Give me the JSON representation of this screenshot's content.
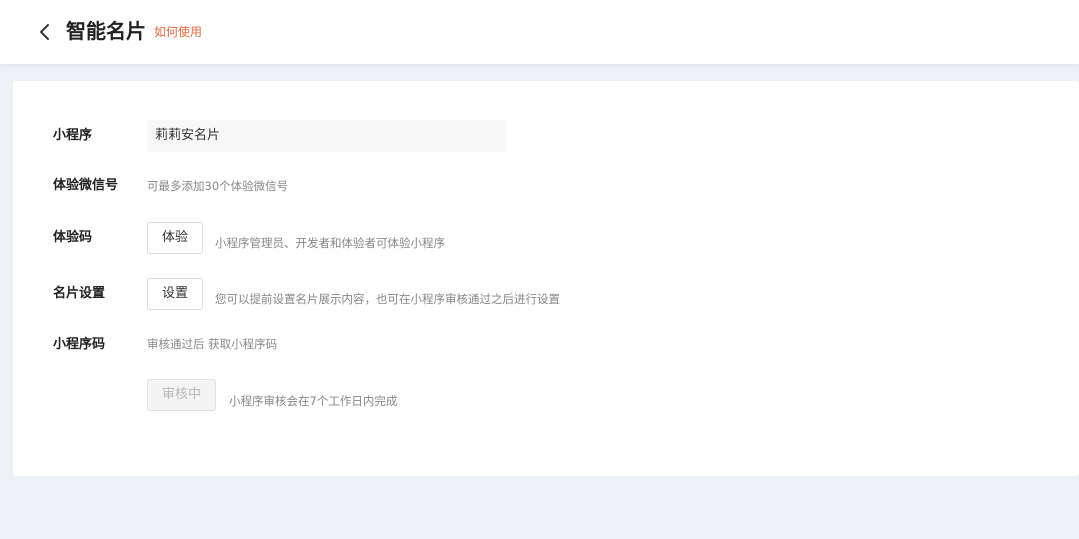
{
  "header": {
    "title": "智能名片",
    "help_link": "如何使用",
    "back_icon": "chevron-left-icon"
  },
  "form": {
    "mini_program": {
      "label": "小程序",
      "value": "莉莉安名片"
    },
    "test_wechat": {
      "label": "体验微信号",
      "hint": "可最多添加30个体验微信号"
    },
    "test_code": {
      "label": "体验码",
      "button": "体验",
      "hint": "小程序管理员、开发者和体验者可体验小程序"
    },
    "card_settings": {
      "label": "名片设置",
      "button": "设置",
      "hint": "您可以提前设置名片展示内容，也可在小程序审核通过之后进行设置"
    },
    "mini_code": {
      "label": "小程序码",
      "hint": "审核通过后 获取小程序码"
    },
    "review": {
      "button": "审核中",
      "hint": "小程序审核会在7个工作日内完成"
    }
  },
  "colors": {
    "accent": "#e96a3f",
    "background": "#edf0f4"
  }
}
